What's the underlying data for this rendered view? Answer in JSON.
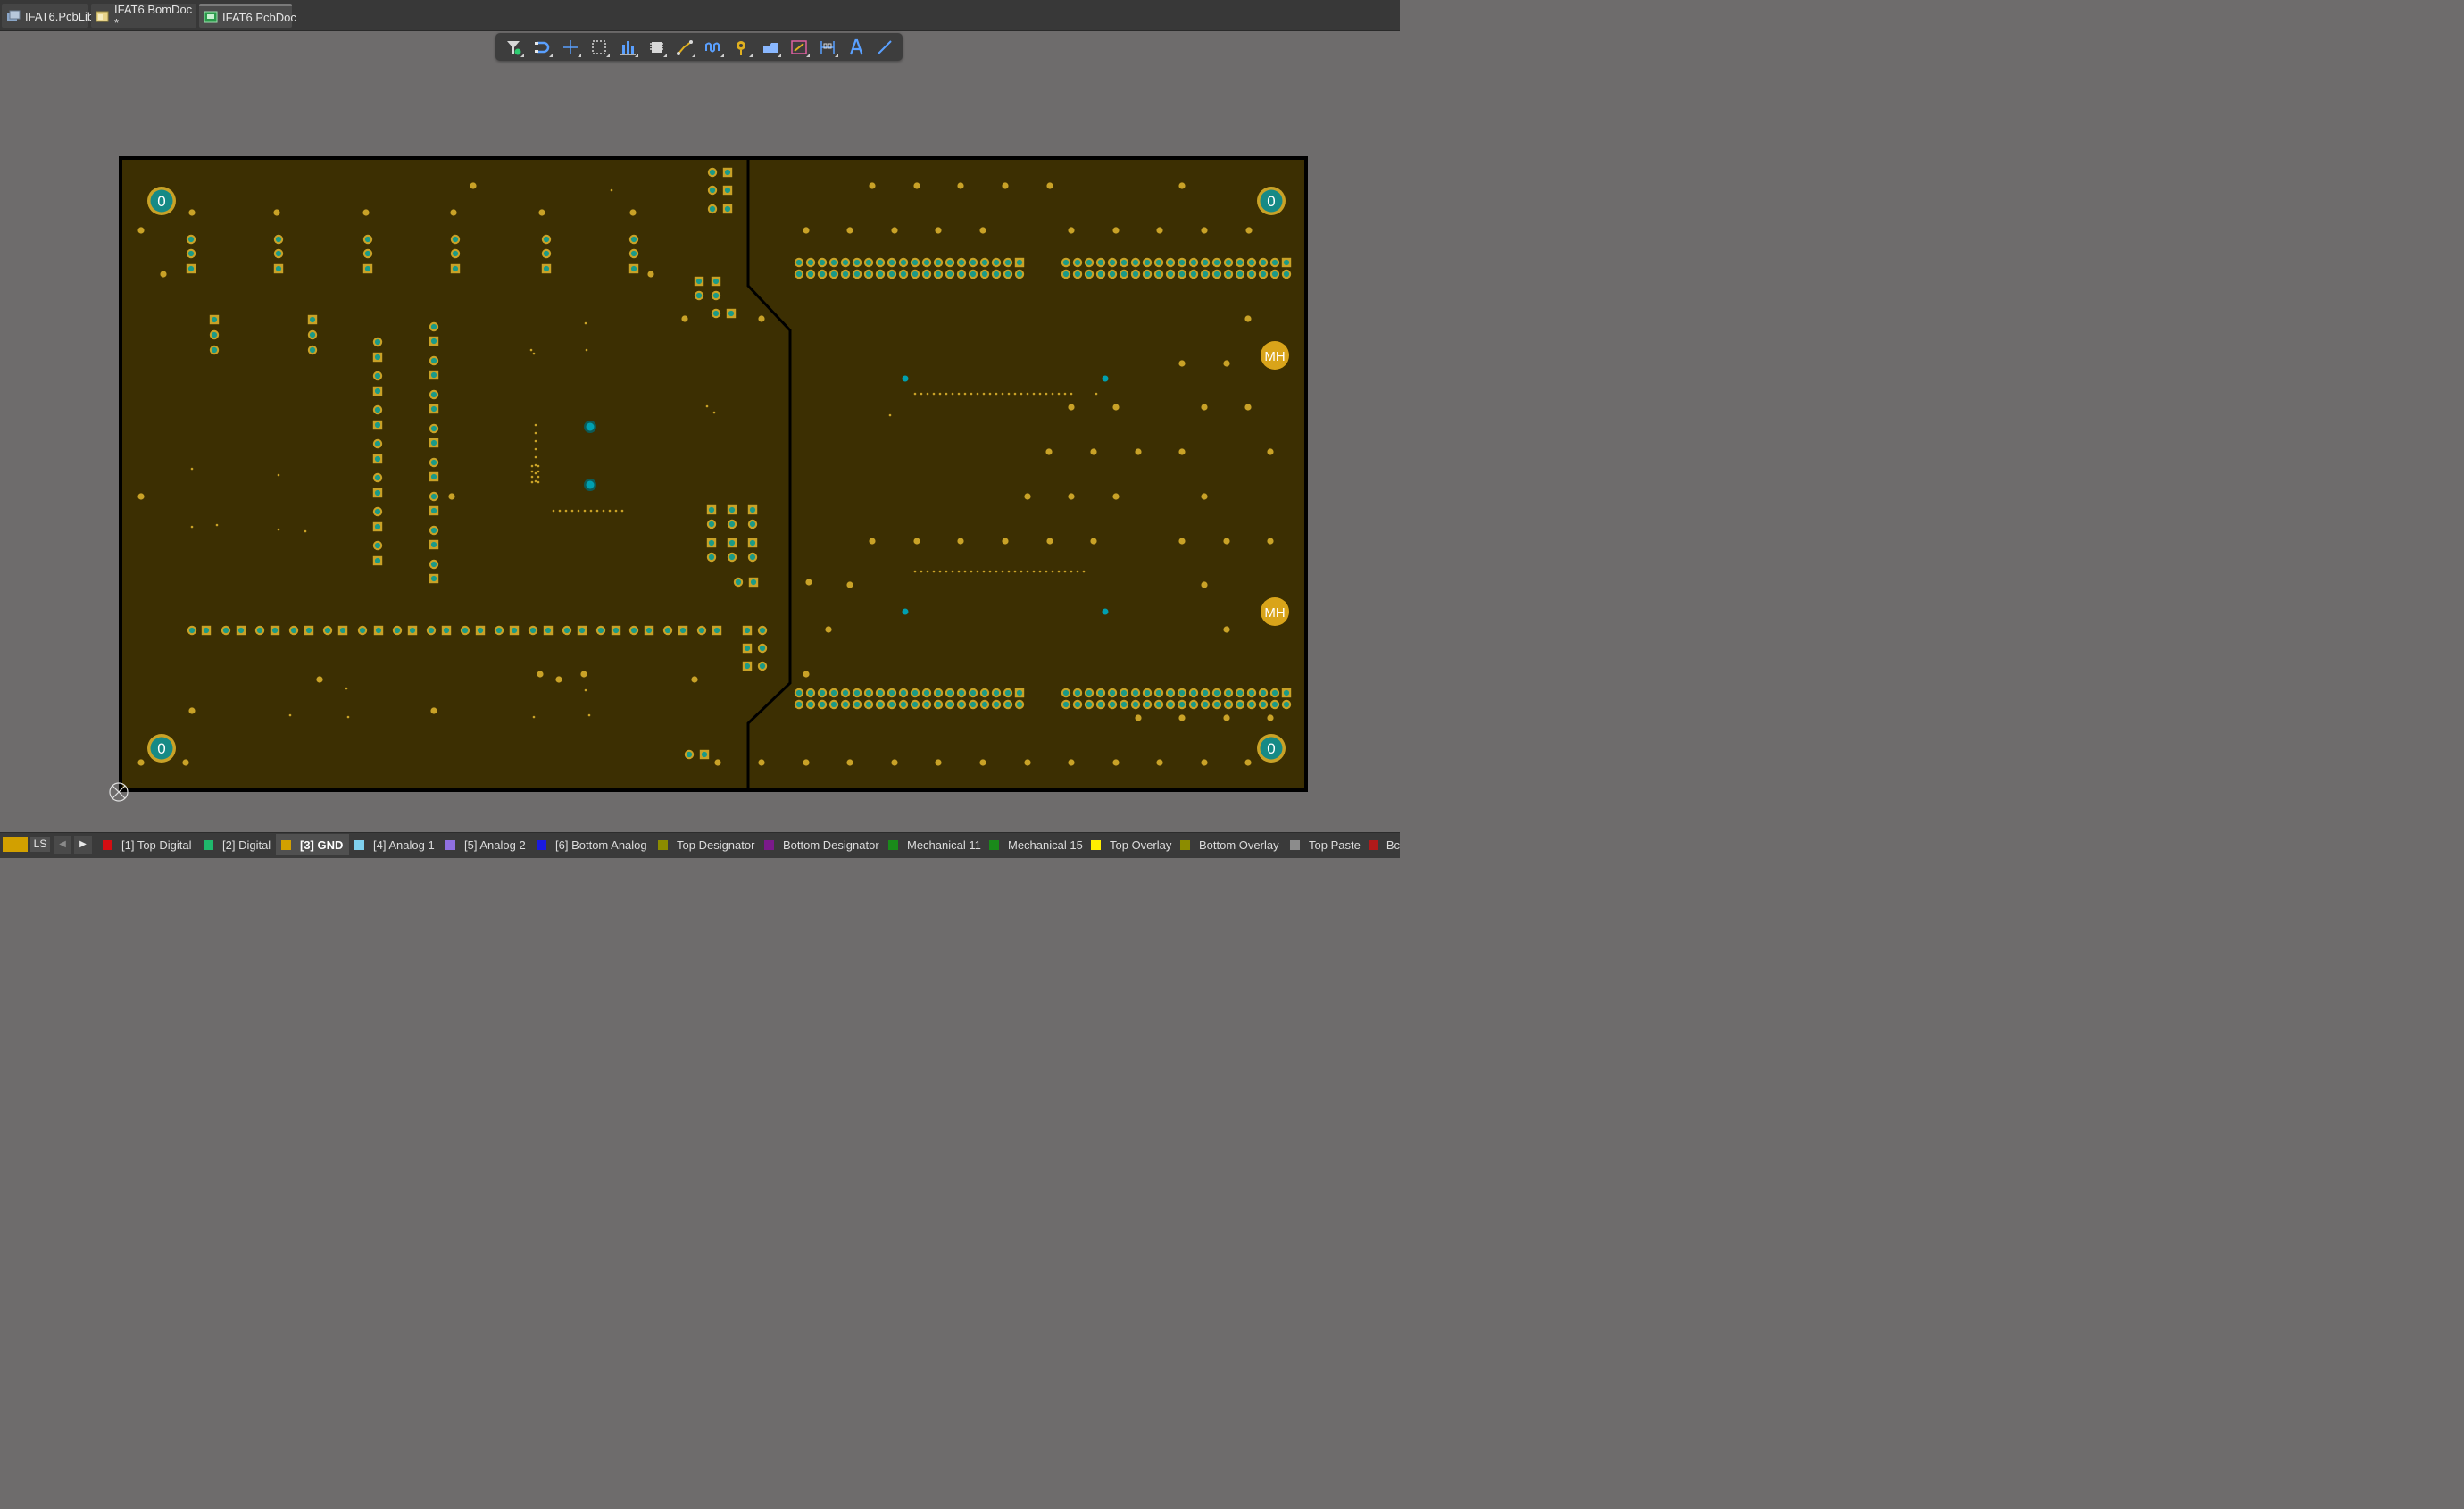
{
  "tabs": [
    {
      "label": "IFAT6.PcbLib",
      "icon": "pcblib-icon",
      "active": false
    },
    {
      "label": "IFAT6.BomDoc *",
      "icon": "bomdoc-icon",
      "active": false
    },
    {
      "label": "IFAT6.PcbDoc",
      "icon": "pcbdoc-icon",
      "active": true
    }
  ],
  "toolbar": {
    "tools": [
      {
        "name": "filter-tool-button",
        "icon": "filter-icon"
      },
      {
        "name": "snap-tool-button",
        "icon": "magnet-icon"
      },
      {
        "name": "move-tool-button",
        "icon": "crosshair-icon"
      },
      {
        "name": "select-tool-button",
        "icon": "select-rectangle-icon"
      },
      {
        "name": "align-tool-button",
        "icon": "align-icon"
      },
      {
        "name": "component-tool-button",
        "icon": "component-icon"
      },
      {
        "name": "route-tool-button",
        "icon": "route-icon"
      },
      {
        "name": "length-tune-tool-button",
        "icon": "length-tune-icon"
      },
      {
        "name": "via-tool-button",
        "icon": "via-icon"
      },
      {
        "name": "region-tool-button",
        "icon": "region-icon"
      },
      {
        "name": "shape-tool-button",
        "icon": "shape-icon"
      },
      {
        "name": "dimension-tool-button",
        "icon": "dimension-icon"
      },
      {
        "name": "text-tool-button",
        "icon": "text-icon"
      },
      {
        "name": "line-tool-button",
        "icon": "line-icon"
      }
    ]
  },
  "board": {
    "large_pad_label": "0",
    "mounting_hole_label": "MH",
    "colors": {
      "board": "#3c2f02",
      "outline": "#000000",
      "pad": "#c9a227",
      "hole": "#1a9a88",
      "via": "#00a0b0"
    }
  },
  "status": {
    "ls_label": "LS",
    "prev_label": "◀",
    "next_label": "▶",
    "layers": [
      {
        "label": "[1] Top Digital",
        "color": "#d40e12",
        "active": false
      },
      {
        "label": "[2] Digital",
        "color": "#1fb86c",
        "active": false
      },
      {
        "label": "[3] GND",
        "color": "#d2a000",
        "active": true
      },
      {
        "label": "[4] Analog 1",
        "color": "#7fd0ee",
        "active": false
      },
      {
        "label": "[5] Analog 2",
        "color": "#8f6fe0",
        "active": false
      },
      {
        "label": "[6] Bottom Analog",
        "color": "#1a1ae0",
        "active": false
      },
      {
        "label": "Top Designator",
        "color": "#8c8c00",
        "active": false
      },
      {
        "label": "Bottom Designator",
        "color": "#7a1a8a",
        "active": false
      },
      {
        "label": "Mechanical 11",
        "color": "#1a8a1a",
        "active": false
      },
      {
        "label": "Mechanical 15",
        "color": "#1a8a1a",
        "active": false
      },
      {
        "label": "Top Overlay",
        "color": "#ffee00",
        "active": false
      },
      {
        "label": "Bottom Overlay",
        "color": "#8c8c00",
        "active": false
      },
      {
        "label": "Top Paste",
        "color": "#8c8c8c",
        "active": false
      },
      {
        "label": "Bc",
        "color": "#b01a1a",
        "active": false
      }
    ]
  }
}
